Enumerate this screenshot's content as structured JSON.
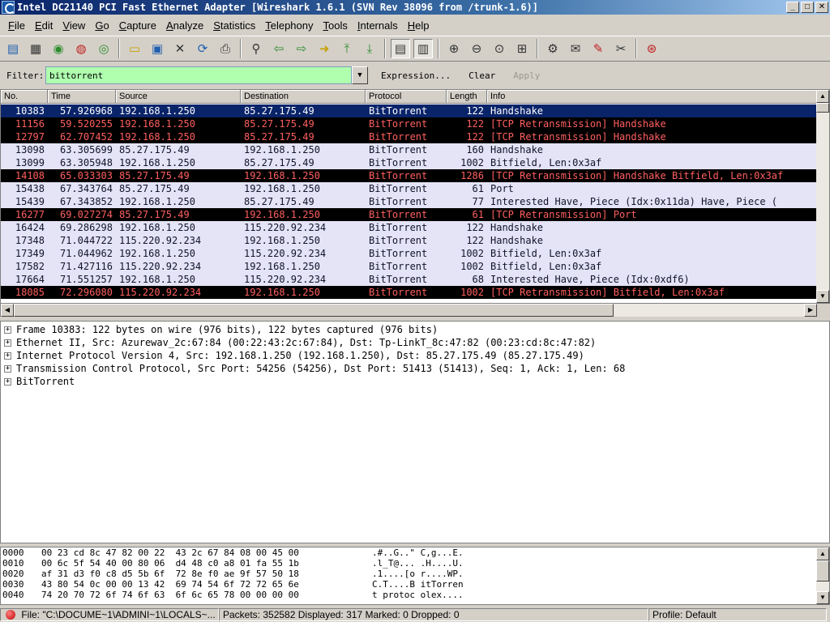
{
  "window": {
    "title": "Intel DC21140 PCI Fast Ethernet Adapter   [Wireshark 1.6.1  (SVN Rev 38096 from /trunk-1.6)]",
    "buttons": [
      "_",
      "□",
      "✕"
    ]
  },
  "menu": [
    "File",
    "Edit",
    "View",
    "Go",
    "Capture",
    "Analyze",
    "Statistics",
    "Telephony",
    "Tools",
    "Internals",
    "Help"
  ],
  "toolbar": {
    "icons": [
      {
        "name": "interfaces-icon",
        "glyph": "▤"
      },
      {
        "name": "options-icon",
        "glyph": "▦"
      },
      {
        "name": "start-capture-icon",
        "glyph": "◉"
      },
      {
        "name": "stop-capture-icon",
        "glyph": "◍"
      },
      {
        "name": "restart-capture-icon",
        "glyph": "◎"
      },
      {
        "name": "open-file-icon",
        "glyph": "▭"
      },
      {
        "name": "save-file-icon",
        "glyph": "▣"
      },
      {
        "name": "close-file-icon",
        "glyph": "✕"
      },
      {
        "name": "reload-icon",
        "glyph": "⟳"
      },
      {
        "name": "print-icon",
        "glyph": "⎙"
      },
      {
        "name": "find-icon",
        "glyph": "⚲"
      },
      {
        "name": "go-back-icon",
        "glyph": "⇦"
      },
      {
        "name": "go-forward-icon",
        "glyph": "⇨"
      },
      {
        "name": "go-to-packet-icon",
        "glyph": "➜"
      },
      {
        "name": "first-packet-icon",
        "glyph": "⤒"
      },
      {
        "name": "last-packet-icon",
        "glyph": "⤓"
      },
      {
        "name": "colorize-icon",
        "glyph": "▤"
      },
      {
        "name": "auto-scroll-icon",
        "glyph": "▥"
      },
      {
        "name": "zoom-in-icon",
        "glyph": "⊕"
      },
      {
        "name": "zoom-out-icon",
        "glyph": "⊖"
      },
      {
        "name": "normal-size-icon",
        "glyph": "⊙"
      },
      {
        "name": "resize-columns-icon",
        "glyph": "⊞"
      },
      {
        "name": "capture-filters-icon",
        "glyph": "⚙"
      },
      {
        "name": "display-filters-icon",
        "glyph": "✉"
      },
      {
        "name": "coloring-rules-icon",
        "glyph": "✎"
      },
      {
        "name": "preferences-icon",
        "glyph": "✂"
      },
      {
        "name": "help-icon",
        "glyph": "⊛"
      }
    ]
  },
  "filter": {
    "label": "Filter:",
    "value": "bittorrent",
    "expression_label": "Expression...",
    "clear_label": "Clear",
    "apply_label": "Apply",
    "valid_color": "#afffaf"
  },
  "packet_list": {
    "columns": [
      "No.",
      "Time",
      "Source",
      "Destination",
      "Protocol",
      "Length",
      "Info"
    ],
    "rows": [
      {
        "no": "10383",
        "time": "57.926968",
        "src": "192.168.1.250",
        "dst": "85.27.175.49",
        "proto": "BitTorrent",
        "len": "122",
        "info": "Handshake",
        "style": "selected"
      },
      {
        "no": "11156",
        "time": "59.520255",
        "src": "192.168.1.250",
        "dst": "85.27.175.49",
        "proto": "BitTorrent",
        "len": "122",
        "info": "[TCP Retransmission] Handshake",
        "style": "bad"
      },
      {
        "no": "12797",
        "time": "62.707452",
        "src": "192.168.1.250",
        "dst": "85.27.175.49",
        "proto": "BitTorrent",
        "len": "122",
        "info": "[TCP Retransmission] Handshake",
        "style": "bad"
      },
      {
        "no": "13098",
        "time": "63.305699",
        "src": "85.27.175.49",
        "dst": "192.168.1.250",
        "proto": "BitTorrent",
        "len": "160",
        "info": "Handshake",
        "style": "normal"
      },
      {
        "no": "13099",
        "time": "63.305948",
        "src": "192.168.1.250",
        "dst": "85.27.175.49",
        "proto": "BitTorrent",
        "len": "1002",
        "info": "Bitfield, Len:0x3af",
        "style": "normal"
      },
      {
        "no": "14108",
        "time": "65.033303",
        "src": "85.27.175.49",
        "dst": "192.168.1.250",
        "proto": "BitTorrent",
        "len": "1286",
        "info": "[TCP Retransmission] Handshake  Bitfield, Len:0x3af",
        "style": "bad"
      },
      {
        "no": "15438",
        "time": "67.343764",
        "src": "85.27.175.49",
        "dst": "192.168.1.250",
        "proto": "BitTorrent",
        "len": "61",
        "info": "Port",
        "style": "normal"
      },
      {
        "no": "15439",
        "time": "67.343852",
        "src": "192.168.1.250",
        "dst": "85.27.175.49",
        "proto": "BitTorrent",
        "len": "77",
        "info": "Interested  Have, Piece (Idx:0x11da)  Have, Piece (",
        "style": "normal"
      },
      {
        "no": "16277",
        "time": "69.027274",
        "src": "85.27.175.49",
        "dst": "192.168.1.250",
        "proto": "BitTorrent",
        "len": "61",
        "info": "[TCP Retransmission] Port",
        "style": "bad"
      },
      {
        "no": "16424",
        "time": "69.286298",
        "src": "192.168.1.250",
        "dst": "115.220.92.234",
        "proto": "BitTorrent",
        "len": "122",
        "info": "Handshake",
        "style": "normal"
      },
      {
        "no": "17348",
        "time": "71.044722",
        "src": "115.220.92.234",
        "dst": "192.168.1.250",
        "proto": "BitTorrent",
        "len": "122",
        "info": "Handshake",
        "style": "normal"
      },
      {
        "no": "17349",
        "time": "71.044962",
        "src": "192.168.1.250",
        "dst": "115.220.92.234",
        "proto": "BitTorrent",
        "len": "1002",
        "info": "Bitfield, Len:0x3af",
        "style": "normal"
      },
      {
        "no": "17582",
        "time": "71.427116",
        "src": "115.220.92.234",
        "dst": "192.168.1.250",
        "proto": "BitTorrent",
        "len": "1002",
        "info": "Bitfield, Len:0x3af",
        "style": "normal"
      },
      {
        "no": "17664",
        "time": "71.551257",
        "src": "192.168.1.250",
        "dst": "115.220.92.234",
        "proto": "BitTorrent",
        "len": "68",
        "info": "Interested  Have, Piece (Idx:0xdf6)",
        "style": "normal"
      },
      {
        "no": "18085",
        "time": "72.296080",
        "src": "115.220.92.234",
        "dst": "192.168.1.250",
        "proto": "BitTorrent",
        "len": "1002",
        "info": "[TCP Retransmission] Bitfield, Len:0x3af",
        "style": "bad"
      }
    ]
  },
  "details": [
    "Frame 10383: 122 bytes on wire (976 bits), 122 bytes captured (976 bits)",
    "Ethernet II, Src: Azurewav_2c:67:84 (00:22:43:2c:67:84), Dst: Tp-LinkT_8c:47:82 (00:23:cd:8c:47:82)",
    "Internet Protocol Version 4, Src: 192.168.1.250 (192.168.1.250), Dst: 85.27.175.49 (85.27.175.49)",
    "Transmission Control Protocol, Src Port: 54256 (54256), Dst Port: 51413 (51413), Seq: 1, Ack: 1, Len: 68",
    "BitTorrent"
  ],
  "hex": [
    {
      "offset": "0000",
      "bytes": "00 23 cd 8c 47 82 00 22  43 2c 67 84 08 00 45 00",
      "ascii": ".#..G..\" C,g...E."
    },
    {
      "offset": "0010",
      "bytes": "00 6c 5f 54 40 00 80 06  d4 48 c0 a8 01 fa 55 1b",
      "ascii": ".l_T@... .H....U."
    },
    {
      "offset": "0020",
      "bytes": "af 31 d3 f0 c8 d5 5b 6f  72 8e f0 ae 9f 57 50 18",
      "ascii": ".1....[o r....WP."
    },
    {
      "offset": "0030",
      "bytes": "43 80 54 0c 00 00 13 42  69 74 54 6f 72 72 65 6e",
      "ascii": "C.T....B itTorren"
    },
    {
      "offset": "0040",
      "bytes": "74 20 70 72 6f 74 6f 63  6f 6c 65 78 00 00 00 00",
      "ascii": "t protoc olex...."
    }
  ],
  "status": {
    "file": "File: \"C:\\DOCUME~1\\ADMINI~1\\LOCALS~...",
    "packets": "Packets: 352582 Displayed: 317 Marked: 0 Dropped: 0",
    "profile": "Profile: Default"
  }
}
